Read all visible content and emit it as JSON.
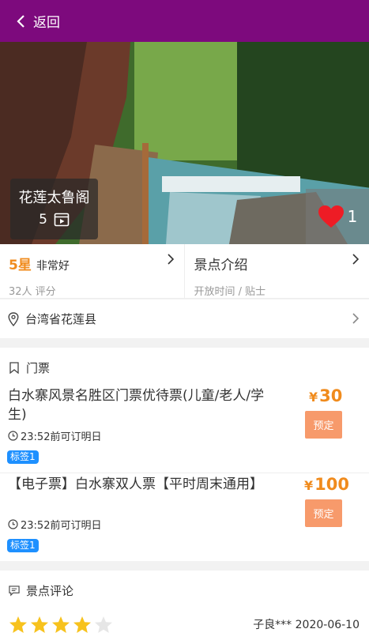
{
  "header": {
    "back_label": "返回",
    "icon": "chevron-left-icon"
  },
  "hero": {
    "spot_name": "花莲太鲁阁",
    "media_count": "5",
    "favorite_count": "1"
  },
  "rating": {
    "value": "5星",
    "word": "非常好",
    "reviews": "32人 评分"
  },
  "intro": {
    "title": "景点介绍",
    "subtitle": "开放时间 / 贴士"
  },
  "location": {
    "address": "台湾省花莲县"
  },
  "tickets": {
    "section_title": "门票",
    "items": [
      {
        "title": "白水寨风景名胜区门票优待票(儿童/老人/学生)",
        "time": "23:52前可订明日",
        "tag": "标签1",
        "currency": "¥",
        "price": "30",
        "button": "预定"
      },
      {
        "title": "【电子票】白水寨双人票【平时周末通用】",
        "time": "23:52前可订明日",
        "tag": "标签1",
        "currency": "¥",
        "price": "100",
        "button": "预定"
      }
    ]
  },
  "reviews": {
    "section_title": "景点评论",
    "stars": 4,
    "max_stars": 5,
    "author_date": "子良*** 2020-06-10"
  },
  "colors": {
    "header": "#7d0a7d",
    "accent": "#f08b1d",
    "tag": "#1e90ff",
    "button": "#f79a6b",
    "heart": "#ee1c25",
    "star": "#f7c21d"
  }
}
